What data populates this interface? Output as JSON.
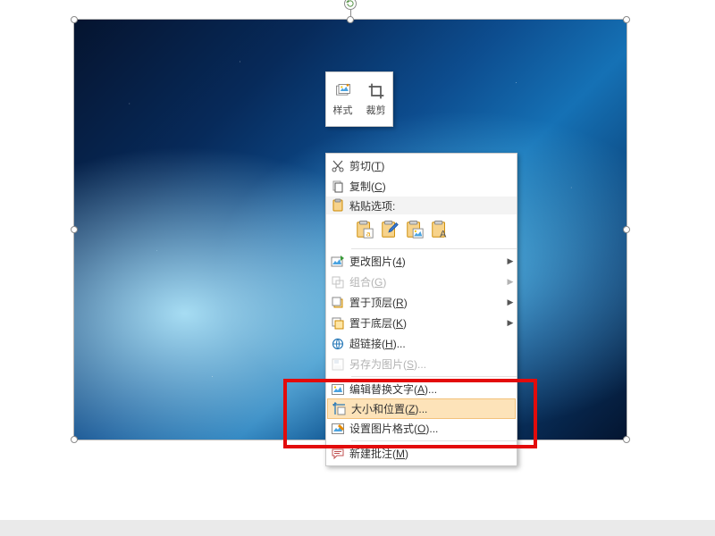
{
  "mini_toolbar": {
    "style_label": "样式",
    "crop_label": "裁剪"
  },
  "menu": {
    "cut": {
      "label": "剪切",
      "accel": "T"
    },
    "copy": {
      "label": "复制",
      "accel": "C"
    },
    "paste_header": "粘贴选项:",
    "change_picture": {
      "label": "更改图片",
      "accel": "4"
    },
    "group": {
      "label": "组合",
      "accel": "G"
    },
    "bring_front": {
      "label": "置于顶层",
      "accel": "R"
    },
    "send_back": {
      "label": "置于底层",
      "accel": "K"
    },
    "hyperlink": {
      "label": "超链接",
      "accel": "H",
      "suffix": "..."
    },
    "save_as_pic": {
      "label": "另存为图片",
      "accel": "S",
      "suffix": "..."
    },
    "alt_text": {
      "label": "编辑替换文字",
      "accel": "A",
      "suffix": "..."
    },
    "size_position": {
      "label": "大小和位置",
      "accel": "Z",
      "suffix": "..."
    },
    "format_picture": {
      "label": "设置图片格式",
      "accel": "O",
      "suffix": "..."
    },
    "new_comment": {
      "label": "新建批注",
      "accel": "M"
    }
  }
}
